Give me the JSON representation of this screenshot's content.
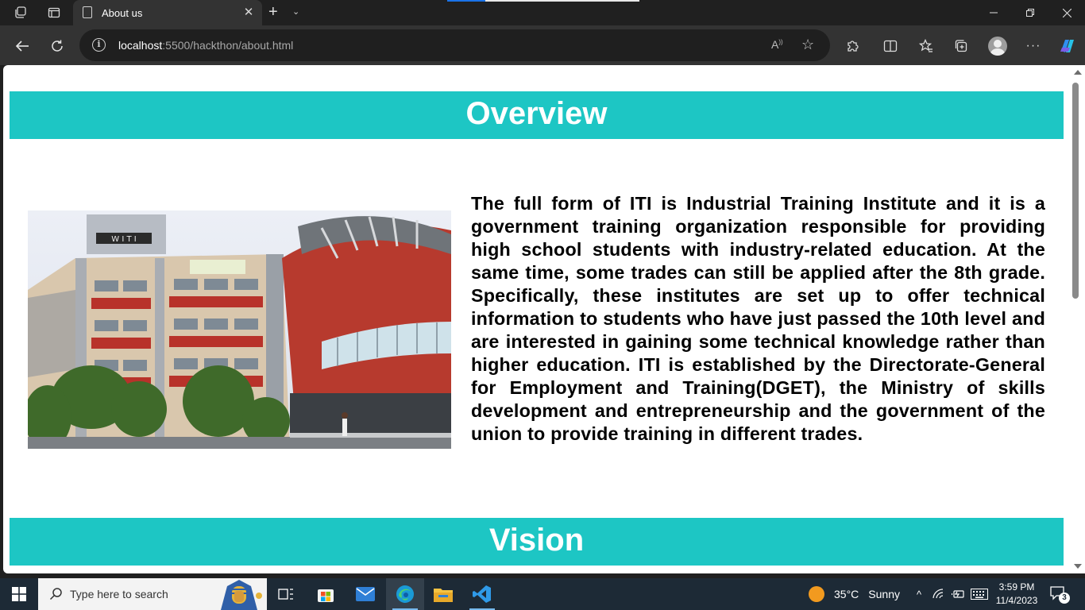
{
  "browser": {
    "tab_title": "About us",
    "url_host": "localhost",
    "url_path": ":5500/hackthon/about.html",
    "load_progress": 0.2
  },
  "page": {
    "overview_heading": "Overview",
    "about_text": "The full form of ITI is Industrial Training Institute and it is a government training organization responsible for providing high school students with industry-related education. At the same time, some trades can still be applied after the 8th grade. Specifically, these institutes are set up to offer technical information to students who have just passed the 10th level and are interested in gaining some technical knowledge rather than higher education. ITI is established by the Directorate-General for Employment and Training(DGET), the Ministry of skills development and entrepreneurship and the government of the union to provide training in different trades.",
    "vision_heading": "Vision",
    "accent_color": "#1dc6c4",
    "photo_sign": "W I T I"
  },
  "taskbar": {
    "search_placeholder": "Type here to search",
    "weather_temp": "35°C",
    "weather_desc": "Sunny",
    "time": "3:59 PM",
    "date": "11/4/2023",
    "notification_count": "3"
  }
}
